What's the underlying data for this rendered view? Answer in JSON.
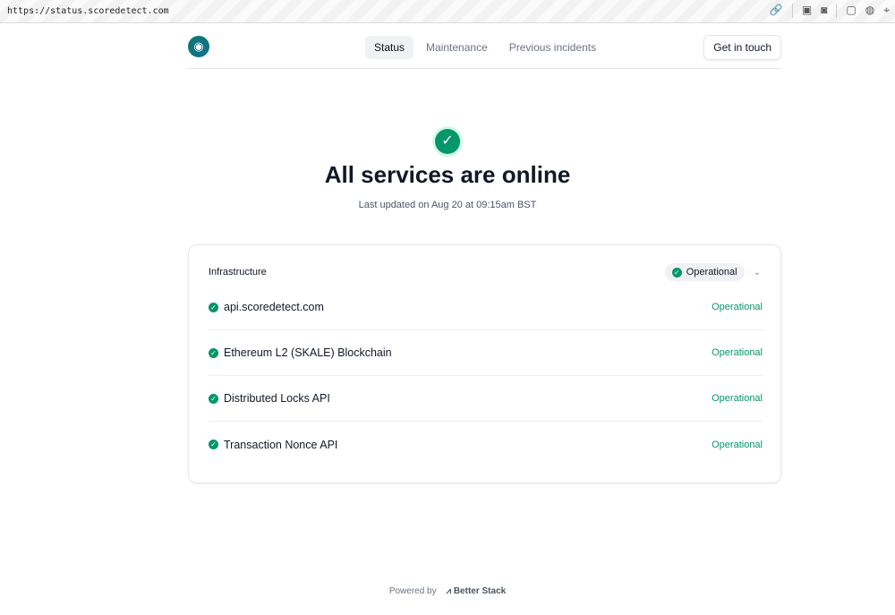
{
  "browser": {
    "url": "https://status.scoredetect.com"
  },
  "header": {
    "nav": [
      "Status",
      "Maintenance",
      "Previous incidents"
    ],
    "cta": "Get in touch"
  },
  "hero": {
    "title": "All services are online",
    "updated": "Last updated on Aug 20 at 09:15am BST"
  },
  "group": {
    "name": "Infrastructure",
    "status": "Operational",
    "services": [
      {
        "name": "api.scoredetect.com",
        "status": "Operational"
      },
      {
        "name": "Ethereum L2 (SKALE) Blockchain",
        "status": "Operational"
      },
      {
        "name": "Distributed Locks API",
        "status": "Operational"
      },
      {
        "name": "Transaction Nonce API",
        "status": "Operational"
      }
    ]
  },
  "footer": {
    "powered": "Powered by",
    "brand": "Better Stack"
  },
  "colors": {
    "accent": "#059669"
  }
}
